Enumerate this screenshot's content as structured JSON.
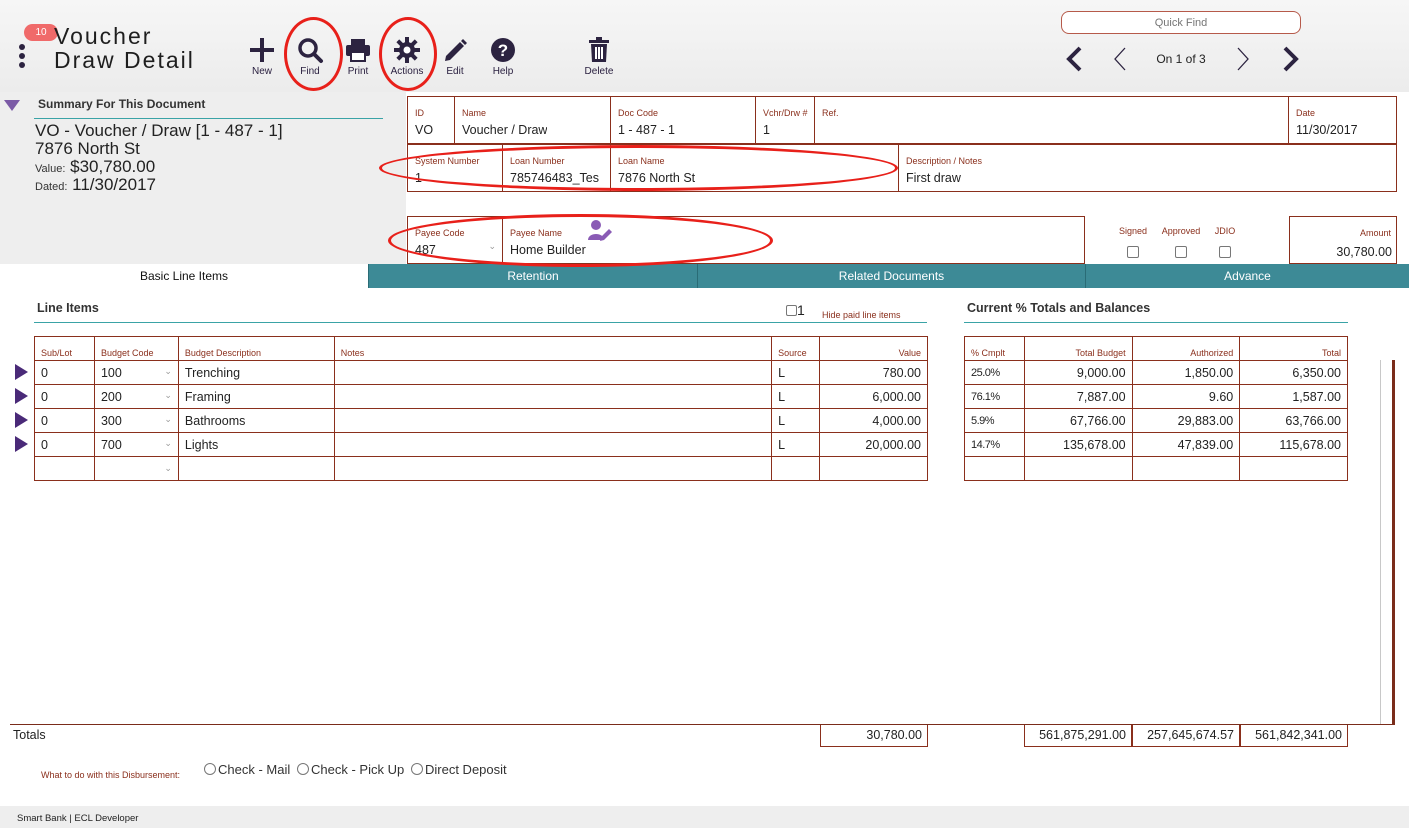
{
  "header": {
    "badge_count": "10",
    "title_line1": "Voucher",
    "title_line2": "Draw Detail",
    "toolbar": {
      "new": "New",
      "find": "Find",
      "print": "Print",
      "actions": "Actions",
      "edit": "Edit",
      "help": "Help",
      "delete": "Delete"
    },
    "quick_find_placeholder": "Quick Find",
    "record_position": "On 1 of 3"
  },
  "summary": {
    "heading": "Summary For This Document",
    "line1": "VO - Voucher / Draw  [1 - 487 - 1]",
    "line2": "7876 North St",
    "value_label": "Value:",
    "value": "$30,780.00",
    "dated_label": "Dated:",
    "dated": "11/30/2017"
  },
  "fields": {
    "id": {
      "label": "ID",
      "value": "VO"
    },
    "name": {
      "label": "Name",
      "value": "Voucher / Draw"
    },
    "doc_code": {
      "label": "Doc Code",
      "value": "1 - 487 - 1"
    },
    "vchr_drw": {
      "label": "Vchr/Drw #",
      "value": "1"
    },
    "ref": {
      "label": "Ref.",
      "value": ""
    },
    "date": {
      "label": "Date",
      "value": "11/30/2017"
    },
    "system_number": {
      "label": "System Number",
      "value": "1"
    },
    "loan_number": {
      "label": "Loan Number",
      "value": "785746483_Tes"
    },
    "loan_name": {
      "label": "Loan Name",
      "value": "7876 North St"
    },
    "description": {
      "label": "Description / Notes",
      "value": "First draw"
    },
    "payee_code": {
      "label": "Payee Code",
      "value": "487"
    },
    "payee_name": {
      "label": "Payee Name",
      "value": "Home Builder"
    },
    "amount": {
      "label": "Amount",
      "value": "30,780.00"
    }
  },
  "flags": {
    "signed": "Signed",
    "approved": "Approved",
    "jdio": "JDIO"
  },
  "tabs": [
    "Basic Line Items",
    "Retention",
    "Related Documents",
    "Advance"
  ],
  "line_items": {
    "heading": "Line Items",
    "hide_paid_count": "1",
    "hide_paid_label": "Hide paid line items",
    "columns": [
      "Sub/Lot",
      "Budget Code",
      "Budget Description",
      "Notes",
      "Source",
      "Value"
    ],
    "rows": [
      {
        "sublot": "0",
        "budget_code": "100",
        "description": "Trenching",
        "notes": "",
        "source": "L",
        "value": "780.00"
      },
      {
        "sublot": "0",
        "budget_code": "200",
        "description": "Framing",
        "notes": "",
        "source": "L",
        "value": "6,000.00"
      },
      {
        "sublot": "0",
        "budget_code": "300",
        "description": "Bathrooms",
        "notes": "",
        "source": "L",
        "value": "4,000.00"
      },
      {
        "sublot": "0",
        "budget_code": "700",
        "description": "Lights",
        "notes": "",
        "source": "L",
        "value": "20,000.00"
      }
    ]
  },
  "balances": {
    "heading": "Current % Totals and Balances",
    "columns": [
      "% Cmplt",
      "Total Budget",
      "Authorized",
      "Total"
    ],
    "rows": [
      {
        "pct": "25.0%",
        "total_budget": "9,000.00",
        "authorized": "1,850.00",
        "total": "6,350.00"
      },
      {
        "pct": "76.1%",
        "total_budget": "7,887.00",
        "authorized": "9.60",
        "total": "1,587.00"
      },
      {
        "pct": "5.9%",
        "total_budget": "67,766.00",
        "authorized": "29,883.00",
        "total": "63,766.00"
      },
      {
        "pct": "14.7%",
        "total_budget": "135,678.00",
        "authorized": "47,839.00",
        "total": "115,678.00"
      }
    ]
  },
  "totals": {
    "label": "Totals",
    "value": "30,780.00",
    "total_budget": "561,875,291.00",
    "authorized": "257,645,674.57",
    "total": "561,842,341.00"
  },
  "disbursement": {
    "label": "What to do with this Disbursement:",
    "options": [
      "Check - Mail",
      "Check - Pick Up",
      "Direct Deposit"
    ]
  },
  "footer": "Smart Bank | ECL Developer",
  "colors": {
    "brand_purple": "#2c2340",
    "field_border": "#8a2f1c",
    "tab_teal": "#3d8a96",
    "annotation_red": "#e8201a",
    "row_arrow": "#4a2a78"
  }
}
